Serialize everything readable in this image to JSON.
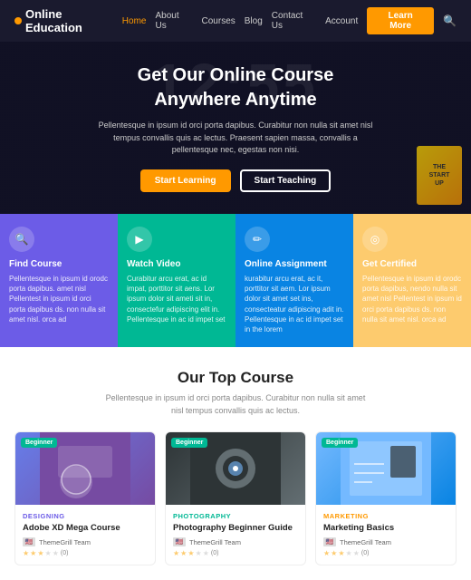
{
  "brand": {
    "name": "Online Education"
  },
  "nav": {
    "links": [
      {
        "label": "Home",
        "active": true
      },
      {
        "label": "About Us",
        "active": false
      },
      {
        "label": "Courses",
        "active": false
      },
      {
        "label": "Blog",
        "active": false
      },
      {
        "label": "Contact Us",
        "active": false
      },
      {
        "label": "Account",
        "active": false
      }
    ],
    "cta": "Learn More",
    "search_icon": "🔍"
  },
  "hero": {
    "bg_text": "12:55",
    "headline_line1": "Get Our Online Course",
    "headline_line2": "Anywhere Anytime",
    "description": "Pellentesque in ipsum id orci porta dapibus. Curabitur non nulla sit amet nisl tempus convallis quis ac lectus. Praesent sapien massa, convallis a pellentesque nec, egestas non nisi.",
    "btn_primary": "Start Learning",
    "btn_outline": "Start Teaching"
  },
  "features": [
    {
      "icon": "🔍",
      "title": "Find Course",
      "desc": "Pellentesque in ipsum id orodc porta dapibus. amet nisl Pellentest in ipsum id orci porta dapibus ds. non nulla sit amet nisl. orca ad",
      "color": "#6c5ce7"
    },
    {
      "icon": "▶",
      "title": "Watch Video",
      "desc": "Curabitur arcu erat, ac id impat, porttitor sit aens. Lor ipsum dolor sit ameti sit in, consectefur adipiscing elit in. Pellentesque in ac id impet set",
      "color": "#00b894"
    },
    {
      "icon": "✏",
      "title": "Online Assignment",
      "desc": "kurabitur arcu erat, ac it, porttitor sit aem. Lor ipsum dolor sit amet set ins, consecteatur adipiscing adit in. Pellentesque in ac id impet set in the lorem",
      "color": "#0984e3"
    },
    {
      "icon": "◎",
      "title": "Get Certified",
      "desc": "Pellentesque in ipsum id orodc porta dapibus, nendo nulla sit amet nisl Pellentest in ipsum id orci porta dapibus ds. non nulla sit amet nisl. orca ad",
      "color": "#fdcb6e"
    }
  ],
  "top_courses": {
    "title": "Our Top Course",
    "subtitle": "Pellentesque in ipsum id orci porta dapibus. Curabitur non nulla sit amet nisl tempus convallis quis ac lectus."
  },
  "courses": [
    {
      "badge": "Beginner",
      "category": "DESIGNING",
      "category_class": "designing",
      "name": "Adobe XD Mega Course",
      "author": "ThemeGrill Team",
      "rating": 3,
      "max_rating": 5,
      "reviews": "(0)",
      "thumb_class": "thumb-designing"
    },
    {
      "badge": "Beginner",
      "category": "PHOTOGRAPHY",
      "category_class": "photography",
      "name": "Photography Beginner Guide",
      "author": "ThemeGrill Team",
      "rating": 3,
      "max_rating": 5,
      "reviews": "(0)",
      "thumb_class": "thumb-photo"
    },
    {
      "badge": "Beginner",
      "category": "MARKETING",
      "category_class": "marketing",
      "name": "Marketing Basics",
      "author": "ThemeGrill Team",
      "rating": 3,
      "max_rating": 5,
      "reviews": "(0)",
      "thumb_class": "thumb-marketing"
    }
  ]
}
